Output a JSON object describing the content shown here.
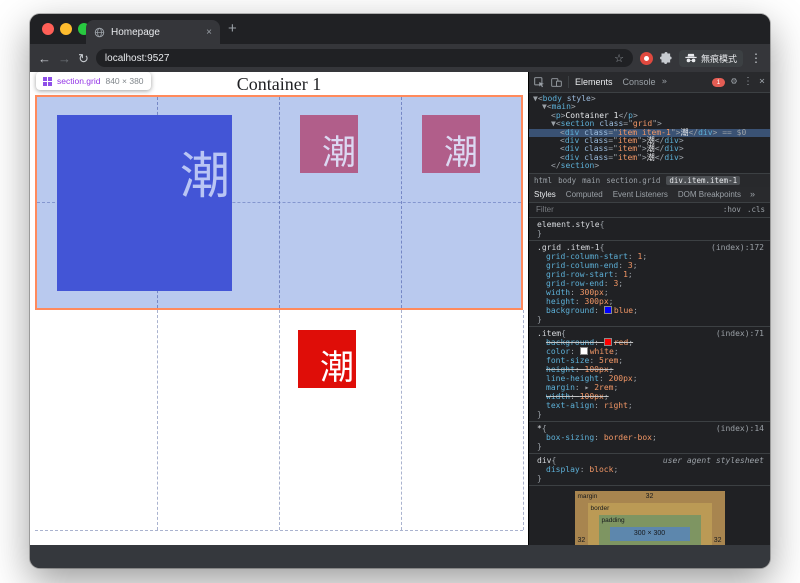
{
  "browser": {
    "tab_title": "Homepage",
    "url": "localhost:9527",
    "incognito_label": "無痕模式"
  },
  "icons": {
    "back": "←",
    "forward": "→",
    "reload": "↻",
    "star": "☆",
    "tab_close": "×",
    "new_tab": "+",
    "kebab": "⋮",
    "more_tabs": "»",
    "gear": "⚙",
    "close": "×",
    "prop_arrow": "▸"
  },
  "colors": {
    "overlay_fill": "#b9c9ee",
    "grid_border": "#ff8a5c",
    "item_blue": "#4355d6",
    "item_red": "#df0d08",
    "item_mauve": "#b15e8a",
    "tooltip_selector_purple": "#9334e6"
  },
  "page": {
    "title": "Container 1",
    "tooltip": {
      "selector": "section.grid",
      "size": "840 × 380"
    },
    "items": [
      {
        "char": "潮"
      },
      {
        "char": "潮"
      },
      {
        "char": "潮"
      },
      {
        "char": "潮"
      }
    ]
  },
  "devtools": {
    "panel_tabs": [
      {
        "label": "Elements",
        "selected": true
      },
      {
        "label": "Console",
        "selected": false
      }
    ],
    "error_count": "1",
    "tree": [
      {
        "indent": 0,
        "parts": [
          [
            "arrow",
            "▼"
          ],
          [
            "punc",
            "<"
          ],
          [
            "tag",
            "body"
          ],
          [
            "aname",
            " style"
          ],
          [
            "punc",
            ">"
          ]
        ]
      },
      {
        "indent": 1,
        "parts": [
          [
            "arrow",
            "▼"
          ],
          [
            "punc",
            "<"
          ],
          [
            "tag",
            "main"
          ],
          [
            "punc",
            ">"
          ]
        ]
      },
      {
        "indent": 2,
        "parts": [
          [
            "punc",
            "<"
          ],
          [
            "tag",
            "p"
          ],
          [
            "punc",
            ">"
          ],
          [
            "text",
            "Container 1"
          ],
          [
            "punc",
            "</"
          ],
          [
            "tag",
            "p"
          ],
          [
            "punc",
            ">"
          ]
        ]
      },
      {
        "indent": 2,
        "parts": [
          [
            "arrow",
            "▼"
          ],
          [
            "punc",
            "<"
          ],
          [
            "tag",
            "section"
          ],
          [
            "aname",
            " class"
          ],
          [
            "punc",
            "=\""
          ],
          [
            "aval",
            "grid"
          ],
          [
            "punc",
            "\">"
          ]
        ]
      },
      {
        "indent": 3,
        "selected": true,
        "parts": [
          [
            "punc",
            "<"
          ],
          [
            "tag",
            "div"
          ],
          [
            "aname",
            " class"
          ],
          [
            "punc",
            "=\""
          ],
          [
            "aval",
            "item item-1"
          ],
          [
            "punc",
            "\">"
          ],
          [
            "text",
            "潮"
          ],
          [
            "punc",
            "</"
          ],
          [
            "tag",
            "div"
          ],
          [
            "punc",
            ">"
          ],
          [
            "dim",
            " == $0"
          ]
        ]
      },
      {
        "indent": 3,
        "parts": [
          [
            "punc",
            "<"
          ],
          [
            "tag",
            "div"
          ],
          [
            "aname",
            " class"
          ],
          [
            "punc",
            "=\""
          ],
          [
            "aval",
            "item"
          ],
          [
            "punc",
            "\">"
          ],
          [
            "text",
            "潮"
          ],
          [
            "punc",
            "</"
          ],
          [
            "tag",
            "div"
          ],
          [
            "punc",
            ">"
          ]
        ]
      },
      {
        "indent": 3,
        "parts": [
          [
            "punc",
            "<"
          ],
          [
            "tag",
            "div"
          ],
          [
            "aname",
            " class"
          ],
          [
            "punc",
            "=\""
          ],
          [
            "aval",
            "item"
          ],
          [
            "punc",
            "\">"
          ],
          [
            "text",
            "潮"
          ],
          [
            "punc",
            "</"
          ],
          [
            "tag",
            "div"
          ],
          [
            "punc",
            ">"
          ]
        ]
      },
      {
        "indent": 3,
        "parts": [
          [
            "punc",
            "<"
          ],
          [
            "tag",
            "div"
          ],
          [
            "aname",
            " class"
          ],
          [
            "punc",
            "=\""
          ],
          [
            "aval",
            "item"
          ],
          [
            "punc",
            "\">"
          ],
          [
            "text",
            "潮"
          ],
          [
            "punc",
            "</"
          ],
          [
            "tag",
            "div"
          ],
          [
            "punc",
            ">"
          ]
        ]
      },
      {
        "indent": 2,
        "parts": [
          [
            "punc",
            "</"
          ],
          [
            "tag",
            "section"
          ],
          [
            "punc",
            ">"
          ]
        ]
      }
    ],
    "breadcrumbs": [
      "html",
      "body",
      "main",
      "section.grid",
      "div.item.item-1"
    ],
    "sidebar_tabs": [
      {
        "label": "Styles",
        "selected": true
      },
      {
        "label": "Computed"
      },
      {
        "label": "Event Listeners"
      },
      {
        "label": "DOM Breakpoints"
      }
    ],
    "filter": {
      "placeholder": "Filter",
      "hov": ":hov",
      "cls": ".cls"
    },
    "rules": [
      {
        "selector": "element.style",
        "link": "",
        "props": []
      },
      {
        "selector": ".grid .item-1",
        "link": "(index):172",
        "props": [
          {
            "name": "grid-column-start",
            "value": "1"
          },
          {
            "name": "grid-column-end",
            "value": "3"
          },
          {
            "name": "grid-row-start",
            "value": "1"
          },
          {
            "name": "grid-row-end",
            "value": "3"
          },
          {
            "name": "width",
            "value": "300px"
          },
          {
            "name": "height",
            "value": "300px"
          },
          {
            "name": "background",
            "value": "blue",
            "swatch": "#0000ff"
          }
        ]
      },
      {
        "selector": ".item",
        "link": "(index):71",
        "props": [
          {
            "name": "background",
            "value": "red",
            "swatch": "#ff0000",
            "struck": true
          },
          {
            "name": "color",
            "value": "white",
            "swatch": "#ffffff"
          },
          {
            "name": "font-size",
            "value": "5rem"
          },
          {
            "name": "height",
            "value": "100px",
            "struck": true
          },
          {
            "name": "line-height",
            "value": "200px"
          },
          {
            "name": "margin",
            "value": "2rem",
            "arrow": true
          },
          {
            "name": "width",
            "value": "100px",
            "struck": true
          },
          {
            "name": "text-align",
            "value": "right"
          }
        ]
      },
      {
        "selector": "*",
        "link": "(index):14",
        "props": [
          {
            "name": "box-sizing",
            "value": "border-box"
          }
        ]
      },
      {
        "selector": "div",
        "link": "user agent stylesheet",
        "link_italic": true,
        "props": [
          {
            "name": "display",
            "value": "block"
          }
        ]
      }
    ],
    "box_model": {
      "margin_label": "margin",
      "border_label": "border",
      "padding_label": "padding",
      "margin_top": "32",
      "margin_left": "32",
      "margin_right": "32",
      "content": "300 × 300"
    }
  }
}
